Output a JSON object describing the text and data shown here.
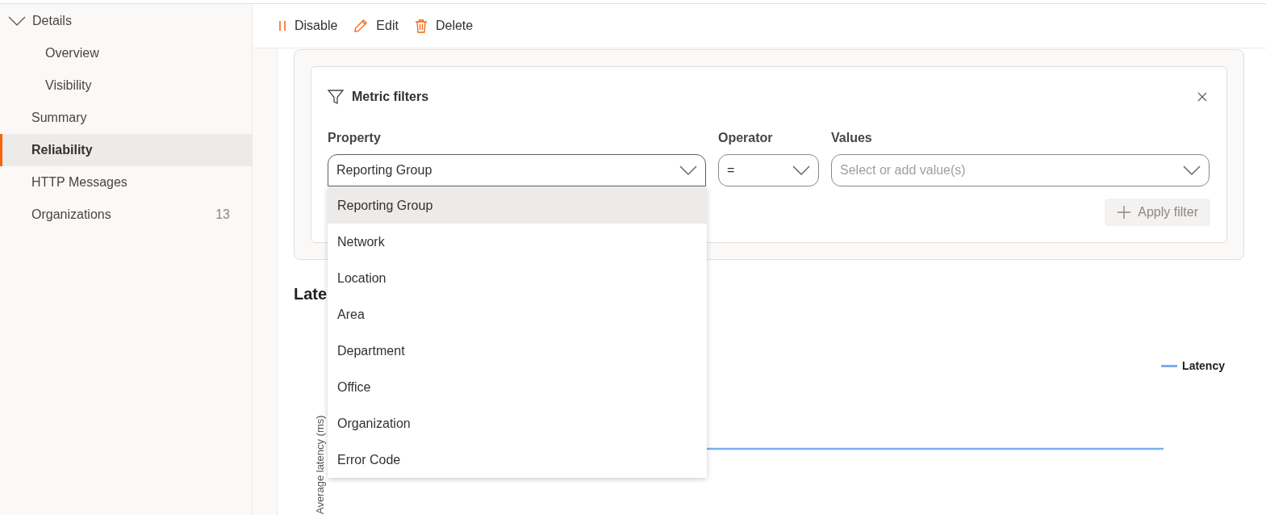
{
  "sidebar": {
    "group": {
      "label": "Details",
      "expanded": true,
      "children": [
        {
          "label": "Overview",
          "selected": false
        },
        {
          "label": "Visibility",
          "selected": false
        }
      ]
    },
    "items": [
      {
        "label": "Summary",
        "selected": false
      },
      {
        "label": "Reliability",
        "selected": true
      },
      {
        "label": "HTTP Messages",
        "selected": false
      },
      {
        "label": "Organizations",
        "selected": false,
        "count": "13"
      }
    ]
  },
  "toolbar": [
    {
      "kind": "pause",
      "label": "Disable"
    },
    {
      "kind": "edit",
      "label": "Edit"
    },
    {
      "kind": "delete",
      "label": "Delete"
    }
  ],
  "metric_filters": {
    "title": "Metric filters",
    "fields": [
      {
        "label": "Property",
        "value": "Reporting Group",
        "expanded": true
      },
      {
        "label": "Operator",
        "value": "=",
        "expanded": false
      },
      {
        "label": "Values",
        "placeholder": "Select or add value(s)",
        "expanded": false
      }
    ],
    "apply_button": {
      "label": "Apply filter",
      "disabled": true
    },
    "dropdown_options": [
      {
        "label": "Reporting Group",
        "selected": true
      },
      {
        "label": "Network",
        "selected": false
      },
      {
        "label": "Location",
        "selected": false
      },
      {
        "label": "Area",
        "selected": false
      },
      {
        "label": "Department",
        "selected": false
      },
      {
        "label": "Office",
        "selected": false
      },
      {
        "label": "Organization",
        "selected": false
      },
      {
        "label": "Error Code",
        "selected": false
      }
    ]
  },
  "chart": {
    "title": "Late",
    "ylabel": "Average latency (ms)",
    "legend": [
      {
        "name": "Latency",
        "color": "#7aaef0"
      }
    ]
  }
}
